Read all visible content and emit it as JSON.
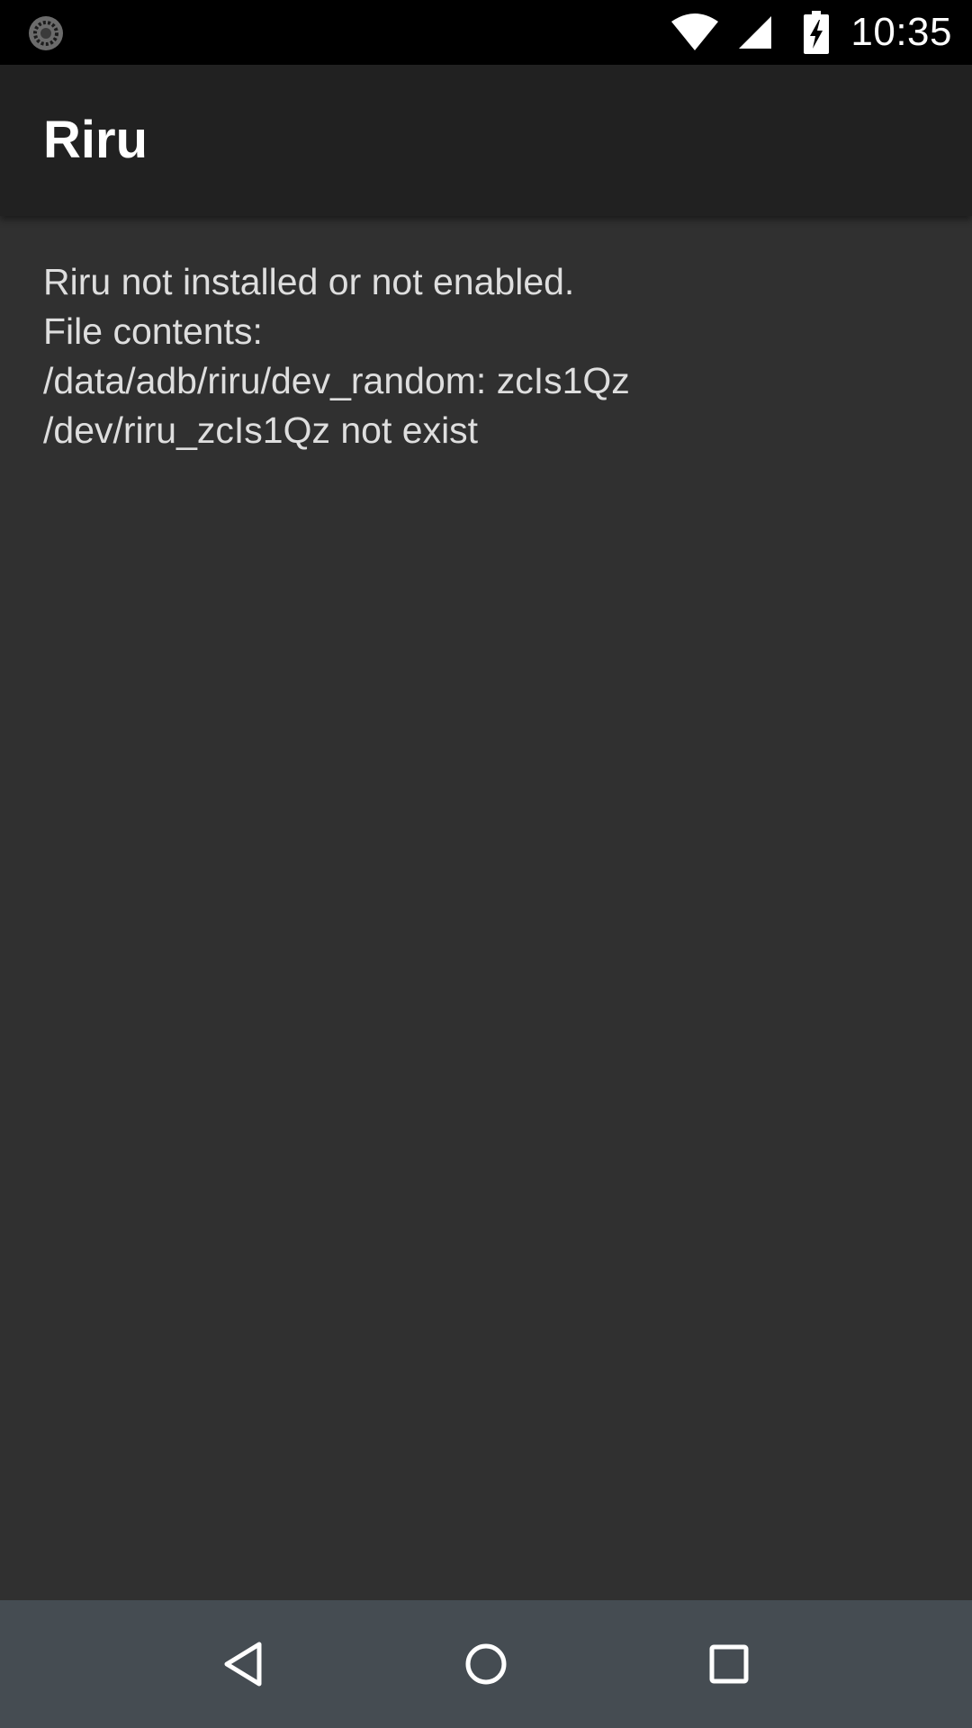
{
  "status_bar": {
    "time": "10:35",
    "icons": [
      "sync-icon",
      "wifi-icon",
      "cell-signal-icon",
      "battery-charging-icon"
    ]
  },
  "app_bar": {
    "title": "Riru"
  },
  "main": {
    "message_lines": [
      "Riru not installed or not enabled.",
      "File contents:",
      "/data/adb/riru/dev_random: zcIs1Qz",
      "/dev/riru_zcIs1Qz not exist"
    ]
  },
  "nav_bar": {
    "icons": [
      "back-icon",
      "home-icon",
      "recents-icon"
    ]
  },
  "colors": {
    "status_bar": "#000000",
    "app_bar": "#212121",
    "background": "#303030",
    "text": "#dedede",
    "nav_bar": "#454c52"
  }
}
